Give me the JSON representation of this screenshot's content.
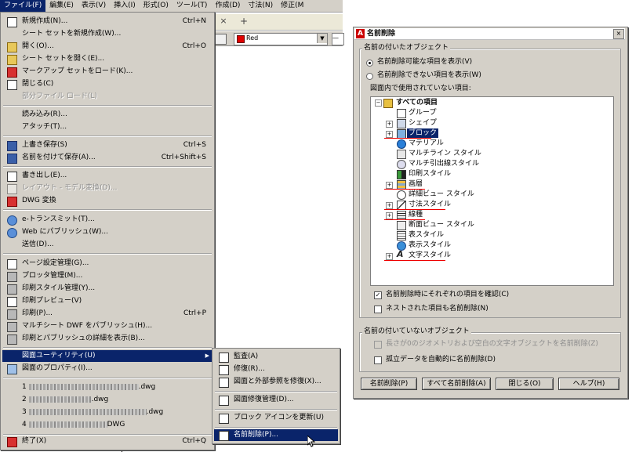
{
  "menubar": {
    "items": [
      "ファイル(F)",
      "編集(E)",
      "表示(V)",
      "挿入(I)",
      "形式(O)",
      "ツール(T)",
      "作成(D)",
      "寸法(N)",
      "修正(M"
    ]
  },
  "app": {
    "tab_close": "×",
    "tab_add": "+",
    "color_value": "Red",
    "linetype_value": "—"
  },
  "file_menu": {
    "items": [
      {
        "label": "新規作成(N)...",
        "shortcut": "Ctrl+N",
        "icon": "new-document-icon"
      },
      {
        "label": "シート セットを新規作成(W)...",
        "shortcut": "",
        "icon": ""
      },
      {
        "label": "開く(O)...",
        "shortcut": "Ctrl+O",
        "icon": "open-folder-icon"
      },
      {
        "label": "シート セットを開く(E)...",
        "shortcut": "",
        "icon": "sheet-set-open-icon"
      },
      {
        "label": "マークアップ セットをロード(K)...",
        "shortcut": "",
        "icon": "markup-icon"
      },
      {
        "label": "閉じる(C)",
        "shortcut": "",
        "icon": "close-document-icon"
      },
      {
        "label": "部分ファイル ロード(L)",
        "shortcut": "",
        "icon": ""
      },
      {
        "label": "読み込み(R)...",
        "shortcut": "",
        "icon": ""
      },
      {
        "label": "アタッチ(T)...",
        "shortcut": "",
        "icon": ""
      },
      {
        "label": "上書き保存(S)",
        "shortcut": "Ctrl+S",
        "icon": "save-icon"
      },
      {
        "label": "名前を付けて保存(A)...",
        "shortcut": "Ctrl+Shift+S",
        "icon": "save-as-icon"
      },
      {
        "label": "書き出し(E)...",
        "shortcut": "",
        "icon": "export-icon"
      },
      {
        "label": "レイアウト - モデル変換(D)...",
        "shortcut": "",
        "icon": "layout-model-icon"
      },
      {
        "label": "DWG 変換",
        "shortcut": "",
        "icon": "dwg-convert-icon"
      },
      {
        "label": "e-トランスミット(T)...",
        "shortcut": "",
        "icon": "etransmit-icon"
      },
      {
        "label": "Web にパブリッシュ(W)...",
        "shortcut": "",
        "icon": "web-publish-icon"
      },
      {
        "label": "送信(D)...",
        "shortcut": "",
        "icon": ""
      },
      {
        "label": "ページ設定管理(G)...",
        "shortcut": "",
        "icon": "page-setup-icon"
      },
      {
        "label": "プロッタ管理(M)...",
        "shortcut": "",
        "icon": "plotter-icon"
      },
      {
        "label": "印刷スタイル管理(Y)...",
        "shortcut": "",
        "icon": "plot-style-icon"
      },
      {
        "label": "印刷プレビュー(V)",
        "shortcut": "",
        "icon": "print-preview-icon"
      },
      {
        "label": "印刷(P)...",
        "shortcut": "Ctrl+P",
        "icon": "print-icon"
      },
      {
        "label": "マルチシート DWF をパブリッシュ(H)...",
        "shortcut": "",
        "icon": "publish-dwf-icon"
      },
      {
        "label": "印刷とパブリッシュの詳細を表示(B)...",
        "shortcut": "",
        "icon": "plot-details-icon"
      },
      {
        "label": "図面ユーティリティ(U)",
        "shortcut": "",
        "icon": ""
      },
      {
        "label": "図面のプロパティ(I)...",
        "shortcut": "",
        "icon": "drawing-properties-icon"
      },
      {
        "label": "1 ",
        "suffix": ".dwg",
        "shortcut": "",
        "icon": ""
      },
      {
        "label": "2 ",
        "suffix": ".dwg",
        "shortcut": "",
        "icon": ""
      },
      {
        "label": "3 ",
        "suffix": ".dwg",
        "shortcut": "",
        "icon": ""
      },
      {
        "label": "4 ",
        "suffix": "DWG",
        "shortcut": "",
        "icon": ""
      },
      {
        "label": "終了(X)",
        "shortcut": "Ctrl+Q",
        "icon": "exit-icon"
      }
    ]
  },
  "submenu": {
    "items": [
      {
        "label": "監査(A)",
        "icon": "audit-icon"
      },
      {
        "label": "修復(R)...",
        "icon": "recover-icon"
      },
      {
        "label": "図面と外部参照を修復(X)...",
        "icon": "recover-xref-icon"
      },
      {
        "label": "図面修復管理(D)...",
        "icon": "drawing-recovery-icon"
      },
      {
        "label": "ブロック アイコンを更新(U)",
        "icon": "block-icon-update-icon"
      },
      {
        "label": "名前削除(P)...",
        "icon": "purge-icon"
      }
    ]
  },
  "dialog": {
    "title": "名前削除",
    "logo_letter": "A",
    "close_glyph": "×",
    "named_group": "名前の付いたオブジェクト",
    "radio1": "名前削除可能な項目を表示(V)",
    "radio2": "名前削除できない項目を表示(W)",
    "tree_label": "図面内で使用されていない項目:",
    "tree_items": [
      "すべての項目",
      "グループ",
      "シェイプ",
      "ブロック",
      "マテリアル",
      "マルチライン スタイル",
      "マルチ引出線スタイル",
      "印刷スタイル",
      "画層",
      "詳細ビュー スタイル",
      "寸法スタイル",
      "線種",
      "断面ビュー スタイル",
      "表スタイル",
      "表示スタイル",
      "文字スタイル"
    ],
    "check1": "名前削除時にそれぞれの項目を確認(C)",
    "check2": "ネストされた項目も名前削除(N)",
    "unnamed_group": "名前の付いていないオブジェクト",
    "check3": "長さが0のジオメトリおよび空白の文字オブジェクトを名前削除(Z)",
    "check4": "孤立データを自動的に名前削除(D)",
    "buttons": [
      "名前削除(P)",
      "すべて名前削除(A)",
      "閉じる(O)",
      "ヘルプ(H)"
    ]
  }
}
